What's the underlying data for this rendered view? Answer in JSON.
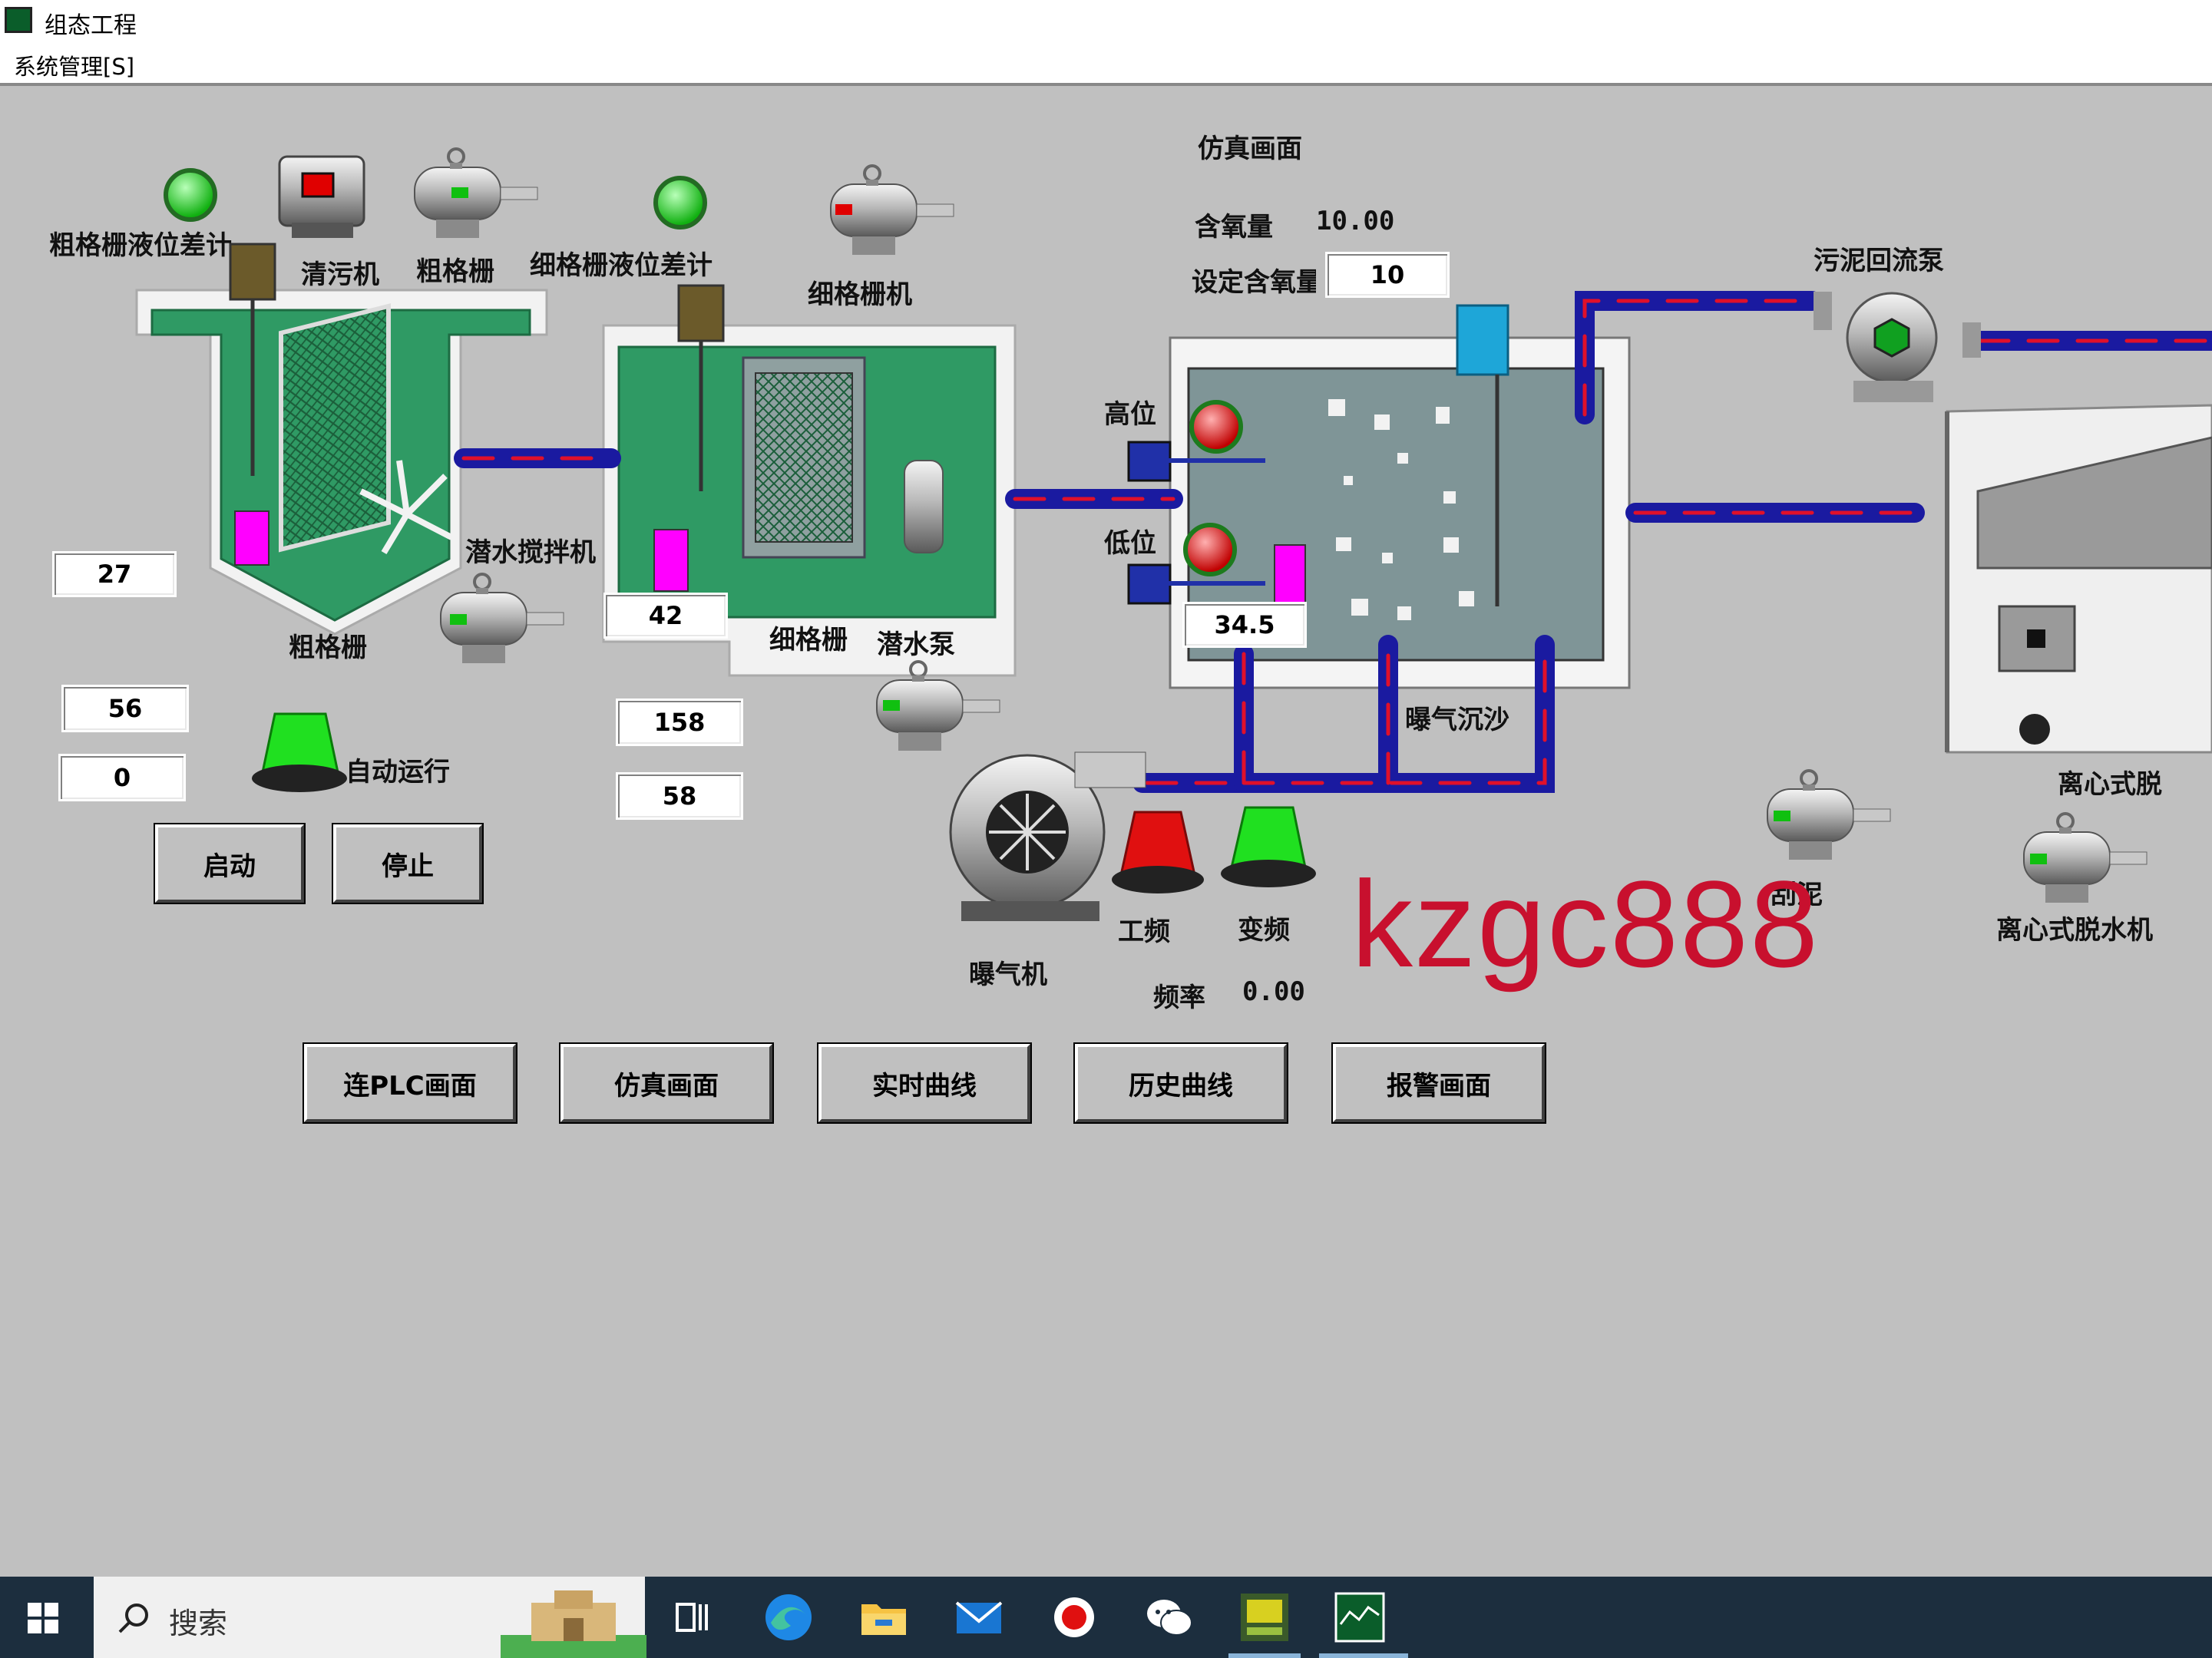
{
  "window": {
    "title": "组态工程",
    "menu": "系统管理[S]"
  },
  "screen_title": "仿真画面",
  "oxygen": {
    "label": "含氧量",
    "value": "10.00",
    "setpoint_label": "设定含氧量",
    "setpoint_value": "10"
  },
  "labels": {
    "coarse_level_diff": "粗格栅液位差计",
    "cleaner": "清污机",
    "coarse_grid_machine": "粗格栅",
    "fine_level_diff": "细格栅液位差计",
    "fine_grid_machine": "细格栅机",
    "sludge_return_pump": "污泥回流泵",
    "high_level": "高位",
    "low_level": "低位",
    "submersible_mixer": "潜水搅拌机",
    "coarse_grid": "粗格栅",
    "fine_grid": "细格栅",
    "submersible_pump": "潜水泵",
    "aeration_grit": "曝气沉沙",
    "auto_run": "自动运行",
    "power_freq": "工频",
    "variable_freq": "变频",
    "blower": "曝气机",
    "frequency_label": "频率",
    "frequency_value": "0.00",
    "scraper": "刮泥",
    "centrifugal_top": "离心式脱",
    "centrifugal_dewater": "离心式脱水机"
  },
  "values": {
    "v27": "27",
    "v42": "42",
    "v34_5": "34.5",
    "v56": "56",
    "v0": "0",
    "v158": "158",
    "v58": "58"
  },
  "controls": {
    "start": "启动",
    "stop": "停止"
  },
  "nav": [
    "连PLC画面",
    "仿真画面",
    "实时曲线",
    "历史曲线",
    "报警画面"
  ],
  "watermark": "kzgc888",
  "taskbar": {
    "search_placeholder": "搜索"
  },
  "colors": {
    "tank_green": "#2f9a64",
    "pipe_blue": "#1a1aa0",
    "pipe_red": "#e0102a",
    "lamp_green": "#20e020",
    "lamp_red": "#e01010",
    "water_gray": "#7f9597"
  }
}
